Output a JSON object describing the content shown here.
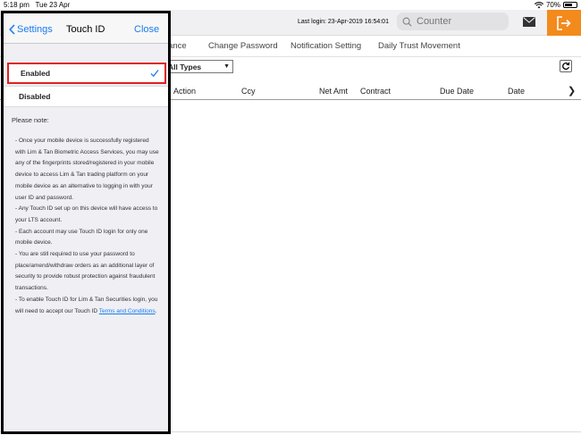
{
  "status_bar": {
    "time": "5:18 pm",
    "date": "Tue 23 Apr",
    "battery": "70%",
    "battery_level": 0.7
  },
  "header": {
    "last_login": "Last login: 23-Apr-2019 16:54:01",
    "search_placeholder": "Counter",
    "icons": [
      "search-icon",
      "mail-icon",
      "logout-icon"
    ],
    "accent_color": "#f28a1c"
  },
  "tabs": [
    "lance",
    "Change Password",
    "Notification Setting",
    "Daily Trust Movement"
  ],
  "filter": {
    "type_value": "All Types"
  },
  "table": {
    "columns": [
      "Action",
      "Ccy",
      "Net Amt",
      "Contract",
      "Due Date",
      "Date"
    ]
  },
  "touch_id": {
    "back_label": "Settings",
    "title": "Touch ID",
    "close_label": "Close",
    "options": [
      {
        "label": "Enabled",
        "selected": true
      },
      {
        "label": "Disabled",
        "selected": false
      }
    ],
    "note_label": "Please note:",
    "notes": [
      "- Once your mobile device is successfully registered with Lim & Tan Biometric Access Services, you may use any of the fingerprints stored/registered in your mobile device to access Lim & Tan trading platform on your mobile device as an alternative to logging in with your user ID and password.",
      "- Any Touch ID set up on this device will have access to your LTS account.",
      "- Each account may use Touch ID login for only one mobile device.",
      "- You are still required to use your password to place/amend/withdraw orders as an additional layer of security to provide robust protection against fraudulent transactions."
    ],
    "last_note_prefix": "- To enable Touch ID for Lim & Tan Securities login, you will need to accept our Touch ID ",
    "terms_link": "Terms and Conditions",
    "last_note_suffix": "."
  }
}
